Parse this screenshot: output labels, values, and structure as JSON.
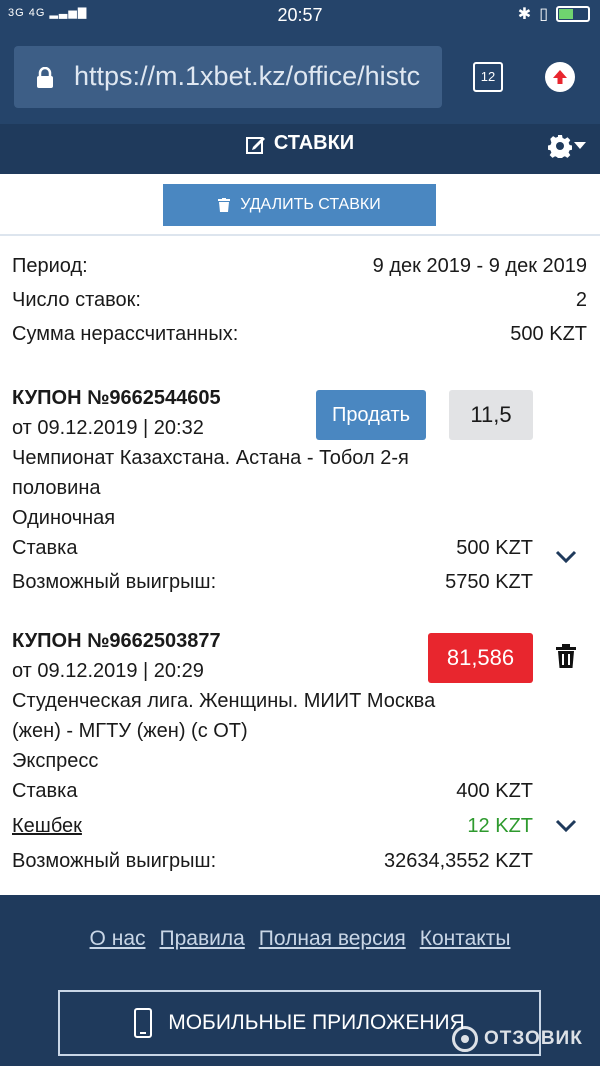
{
  "status_bar": {
    "network": "3G 4G",
    "time": "20:57"
  },
  "browser": {
    "url": "https://m.1xbet.kz/office/histc",
    "tabs_count": "12"
  },
  "header": {
    "title": "СТАВКИ"
  },
  "actions": {
    "delete_bets": "УДАЛИТЬ СТАВКИ"
  },
  "summary": {
    "period_label": "Период:",
    "period_value": "9 дек 2019 - 9 дек 2019",
    "count_label": "Число ставок:",
    "count_value": "2",
    "unsettled_label": "Сумма нерассчитанных:",
    "unsettled_value": "500 KZT"
  },
  "coupons": [
    {
      "title": "КУПОН №9662544605",
      "date": "от 09.12.2019 | 20:32",
      "event_line1": "Чемпионат Казахстана. Астана - Тобол 2-я",
      "event_line2": "половина",
      "type": "Одиночная",
      "stake_label": "Ставка",
      "stake_value": "500 KZT",
      "win_label": "Возможный выигрыш:",
      "win_value": "5750 KZT",
      "sell_label": "Продать",
      "coefficient": "11,5"
    },
    {
      "title": "КУПОН №9662503877",
      "date": "от 09.12.2019 | 20:29",
      "event_line1": "Студенческая лига. Женщины. МИИТ Москва",
      "event_line2": "(жен) - МГТУ (жен) (с ОТ)",
      "type": "Экспресс",
      "stake_label": "Ставка",
      "stake_value": "400 KZT",
      "cashback_label": "Кешбек",
      "cashback_value": "12 KZT",
      "win_label": "Возможный выигрыш:",
      "win_value": "32634,3552 KZT",
      "coefficient": "81,586"
    }
  ],
  "footer": {
    "links": [
      "О нас",
      "Правила",
      "Полная версия",
      "Контакты"
    ],
    "apps_button": "МОБИЛЬНЫЕ ПРИЛОЖЕНИЯ"
  },
  "watermark": "ОТЗОВИК",
  "colors": {
    "header_bg": "#1f3a5c",
    "button_blue": "#4a87c1",
    "coef_red": "#e8262e",
    "cashback_green": "#2e9a2e"
  }
}
